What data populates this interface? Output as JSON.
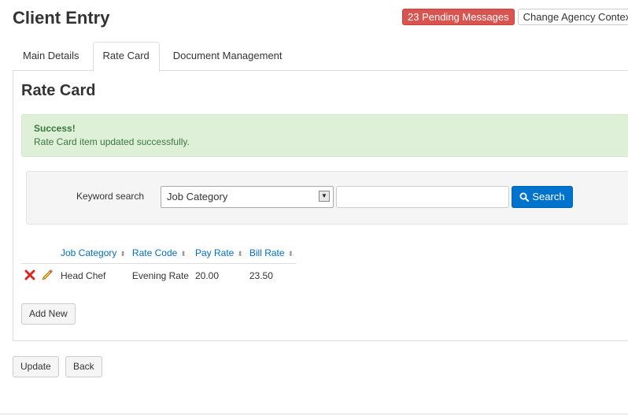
{
  "header": {
    "title": "Client Entry",
    "pending_messages": "23 Pending Messages",
    "change_agency": "Change Agency Context"
  },
  "tabs": [
    {
      "label": "Main Details",
      "active": false
    },
    {
      "label": "Rate Card",
      "active": true
    },
    {
      "label": "Document Management",
      "active": false
    }
  ],
  "section": {
    "title": "Rate Card"
  },
  "alert": {
    "title": "Success!",
    "message": "Rate Card item updated successfully."
  },
  "search": {
    "label": "Keyword search",
    "field_selected": "Job Category",
    "keyword_value": "",
    "button_label": "Search"
  },
  "table": {
    "columns": [
      "Job Category",
      "Rate Code",
      "Pay Rate",
      "Bill Rate"
    ],
    "rows": [
      [
        "Head Chef",
        "Evening Rate",
        "20.00",
        "23.50"
      ]
    ]
  },
  "actions": {
    "add_new": "Add New",
    "update": "Update",
    "back": "Back"
  },
  "colors": {
    "danger": "#d9534f",
    "primary": "#0074cc",
    "success_bg": "#dff0d8",
    "success_text": "#3c763d",
    "link": "#0070c0"
  },
  "icons": {
    "delete": "delete-x-icon",
    "edit": "pencil-icon",
    "search": "magnifier-icon",
    "dropdown": "caret-down-icon"
  }
}
